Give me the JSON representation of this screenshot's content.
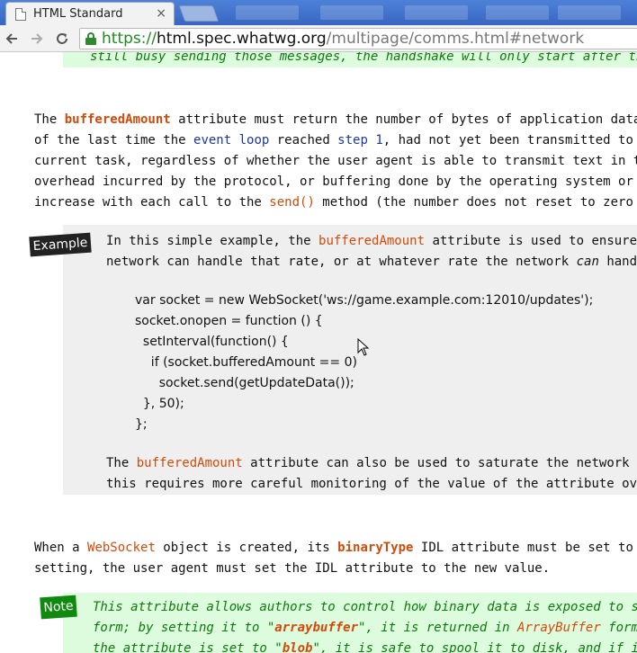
{
  "browser": {
    "tab_title": "HTML Standard",
    "tab_close": "×",
    "url_scheme": "https://",
    "url_host": "html.spec.whatwg.org",
    "url_path": "/multipage/comms.html#network",
    "icons": {
      "back": "back-arrow-icon",
      "forward": "forward-arrow-icon",
      "reload": "reload-icon",
      "lock": "lock-icon",
      "tab": "document-icon"
    },
    "colors": {
      "tabbar": "#3866c2",
      "secure": "#1e8a1e"
    }
  },
  "content": {
    "top_note": "still busy sending those messages, the handshake will only start after the m",
    "para1": {
      "l1_pre": "The ",
      "l1_term": "bufferedAmount",
      "l1_post": " attribute must return the number of bytes of application data (U",
      "l2_pre": "of the last time the ",
      "l2_link1": "event loop",
      "l2_mid": " reached ",
      "l2_link2": "step 1",
      "l2_post": ", had not yet been transmitted to the",
      "l3": "current task, regardless of whether the user agent is able to transmit text in the b",
      "l4": "overhead incurred by the protocol, or buffering done by the operating system or netw",
      "l5_pre": "increase with each call to the ",
      "l5_link": "send()",
      "l5_post": " method (the number does not reset to zero once"
    },
    "example": {
      "label": "Example",
      "l1_pre": "In this simple example, the ",
      "l1_term": "bufferedAmount",
      "l1_post": " attribute is used to ensure tha",
      "l2_pre": "network can handle that rate, or at whatever rate the network ",
      "l2_em": "can",
      "l2_post": " handle,",
      "code": [
        "var socket = new WebSocket('ws://game.example.com:12010/updates');",
        "socket.onopen = function () {",
        "  setInterval(function() {",
        "    if (socket.bufferedAmount == 0)",
        "      socket.send(getUpdateData());",
        "  }, 50);",
        "};"
      ],
      "l3_pre": "The ",
      "l3_term": "bufferedAmount",
      "l3_post": " attribute can also be used to saturate the network with",
      "l4": "this requires more careful monitoring of the value of the attribute over t"
    },
    "para2": {
      "l1_pre": "When a ",
      "l1_link": "WebSocket",
      "l1_mid": " object is created, its ",
      "l1_term": "binaryType",
      "l1_post": " IDL attribute must be set to the",
      "l2": "setting, the user agent must set the IDL attribute to the new value."
    },
    "note": {
      "label": "Note",
      "l1": "This attribute allows authors to control how binary data is exposed to scrip",
      "l2_pre": "form; by setting it to \"",
      "l2_term": "arraybuffer",
      "l2_mid": "\", it is returned in ",
      "l2_link": "ArrayBuffer",
      "l2_post": " form. U",
      "l3_pre": "the attribute is set to \"",
      "l3_term": "blob",
      "l3_post": "\", it is safe to spool it to disk, and if it is"
    }
  }
}
